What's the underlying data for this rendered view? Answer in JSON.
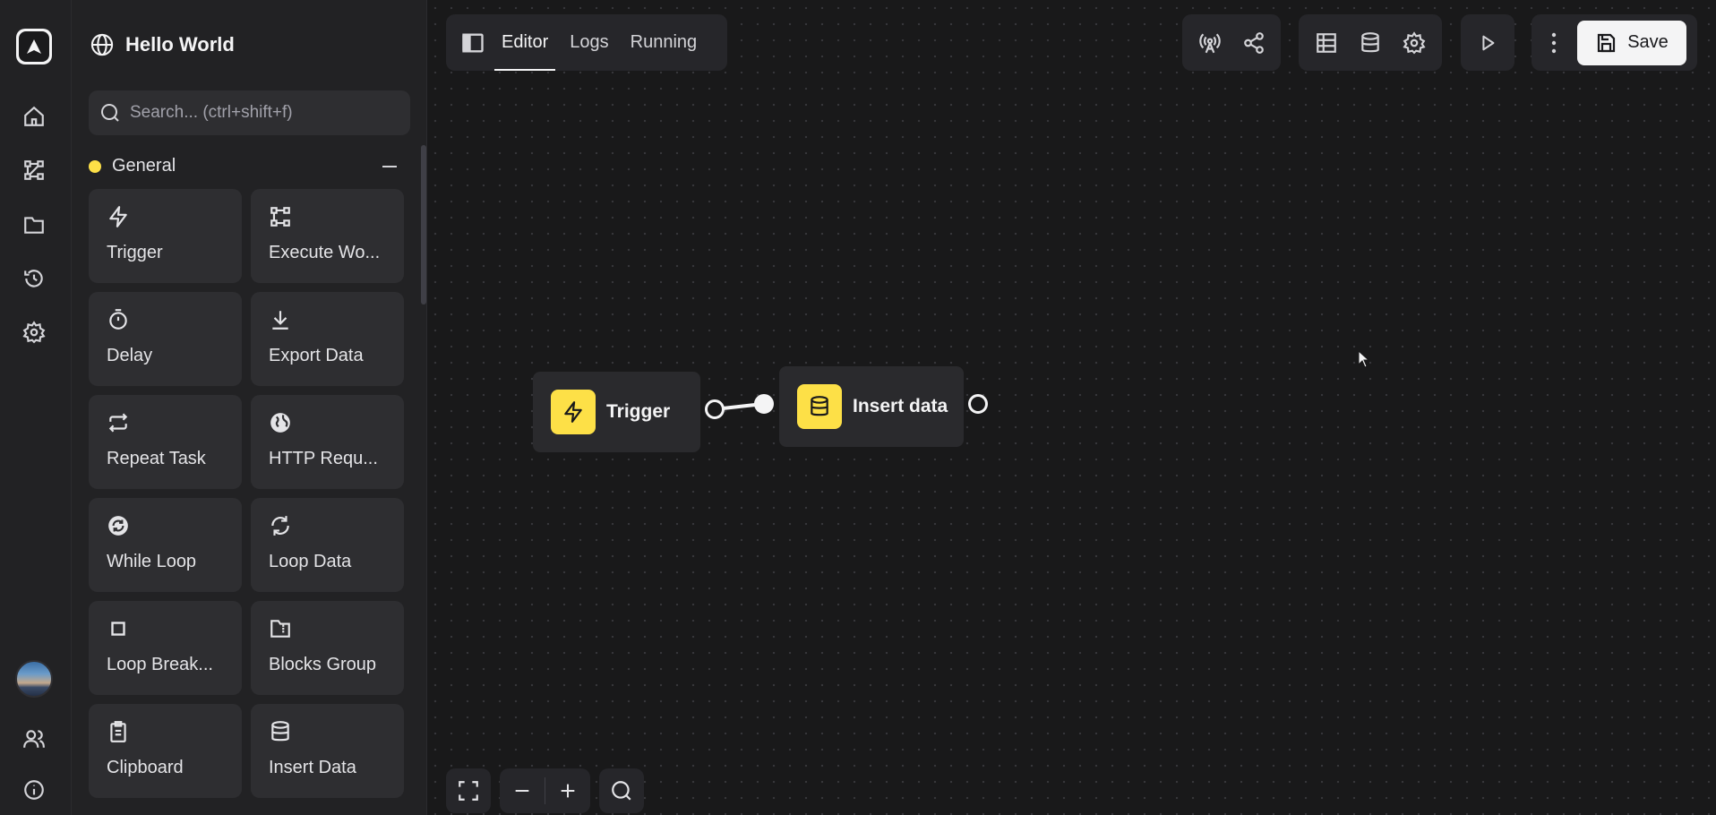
{
  "sidebar": {
    "workflow_title": "Hello World",
    "search_placeholder": "Search... (ctrl+shift+f)",
    "category": {
      "name": "General",
      "color": "#fde047"
    },
    "blocks": [
      {
        "label": "Trigger",
        "icon": "lightning-icon"
      },
      {
        "label": "Execute Wo...",
        "icon": "workflow-icon"
      },
      {
        "label": "Delay",
        "icon": "timer-icon"
      },
      {
        "label": "Export Data",
        "icon": "download-icon"
      },
      {
        "label": "Repeat Task",
        "icon": "repeat-icon"
      },
      {
        "label": "HTTP Requ...",
        "icon": "globe-icon"
      },
      {
        "label": "While Loop",
        "icon": "loop-circle-icon"
      },
      {
        "label": "Loop Data",
        "icon": "refresh-icon"
      },
      {
        "label": "Loop Break...",
        "icon": "stop-square-icon"
      },
      {
        "label": "Blocks Group",
        "icon": "folder-zip-icon"
      },
      {
        "label": "Clipboard",
        "icon": "clipboard-icon"
      },
      {
        "label": "Insert Data",
        "icon": "database-icon"
      }
    ]
  },
  "header": {
    "tabs": [
      {
        "label": "Editor",
        "active": true
      },
      {
        "label": "Logs",
        "active": false
      },
      {
        "label": "Running",
        "active": false
      }
    ],
    "save_label": "Save"
  },
  "nodes": [
    {
      "label": "Trigger",
      "icon": "lightning-icon"
    },
    {
      "label": "Insert data",
      "icon": "database-icon"
    }
  ],
  "colors": {
    "accent": "#fde047",
    "background": "#19191a",
    "panel": "#222224"
  }
}
